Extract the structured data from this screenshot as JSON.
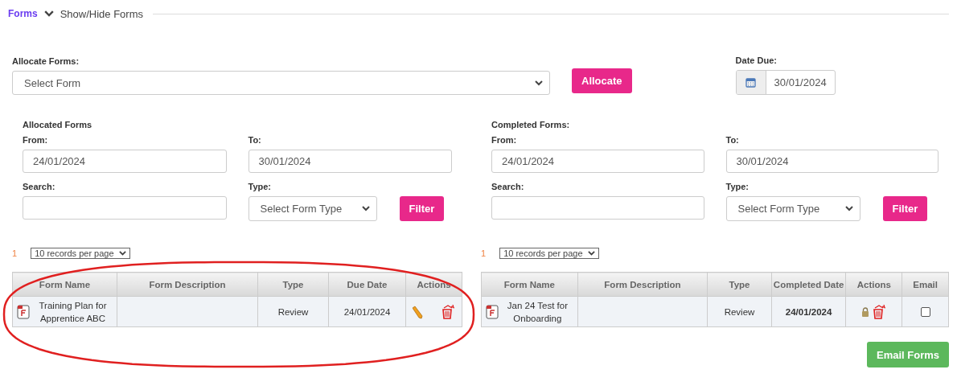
{
  "header": {
    "link": "Forms",
    "toggle": "Show/Hide Forms"
  },
  "allocate": {
    "label": "Allocate Forms:",
    "select": "Select Form",
    "button": "Allocate",
    "date_label": "Date Due:",
    "date": "30/01/2024"
  },
  "panels": [
    {
      "kind": "allocated",
      "title": "Allocated Forms",
      "from_label": "From:",
      "from": "24/01/2024",
      "to_label": "To:",
      "to": "30/01/2024",
      "search_label": "Search:",
      "type_label": "Type:",
      "type_select": "Select Form Type",
      "filter": "Filter",
      "page": "1",
      "page_size": "10 records per page",
      "columns": [
        "Form Name",
        "Form Description",
        "Type",
        "Due Date",
        "Actions"
      ],
      "rows": [
        {
          "name": "Training Plan for Apprentice ABC",
          "type": "Review",
          "date": "24/01/2024",
          "actions": [
            {
              "kind": "edit"
            },
            {
              "kind": "delete"
            }
          ]
        }
      ]
    },
    {
      "kind": "completed",
      "title": "Completed Forms:",
      "from_label": "From:",
      "from": "24/01/2024",
      "to_label": "To:",
      "to": "30/01/2024",
      "search_label": "Search:",
      "type_label": "Type:",
      "type_select": "Select Form Type",
      "filter": "Filter",
      "page": "1",
      "page_size": "10 records per page",
      "columns": [
        "Form Name",
        "Form Description",
        "Type",
        "Completed Date",
        "Actions",
        "Email"
      ],
      "rows": [
        {
          "name": "Jan 24 Test for Onboarding",
          "type": "Review",
          "date": "24/01/2024",
          "actions": [
            {
              "kind": "lock"
            },
            {
              "kind": "delete"
            }
          ],
          "email": {
            "checked": false
          }
        }
      ]
    }
  ],
  "email_button": "Email Forms"
}
